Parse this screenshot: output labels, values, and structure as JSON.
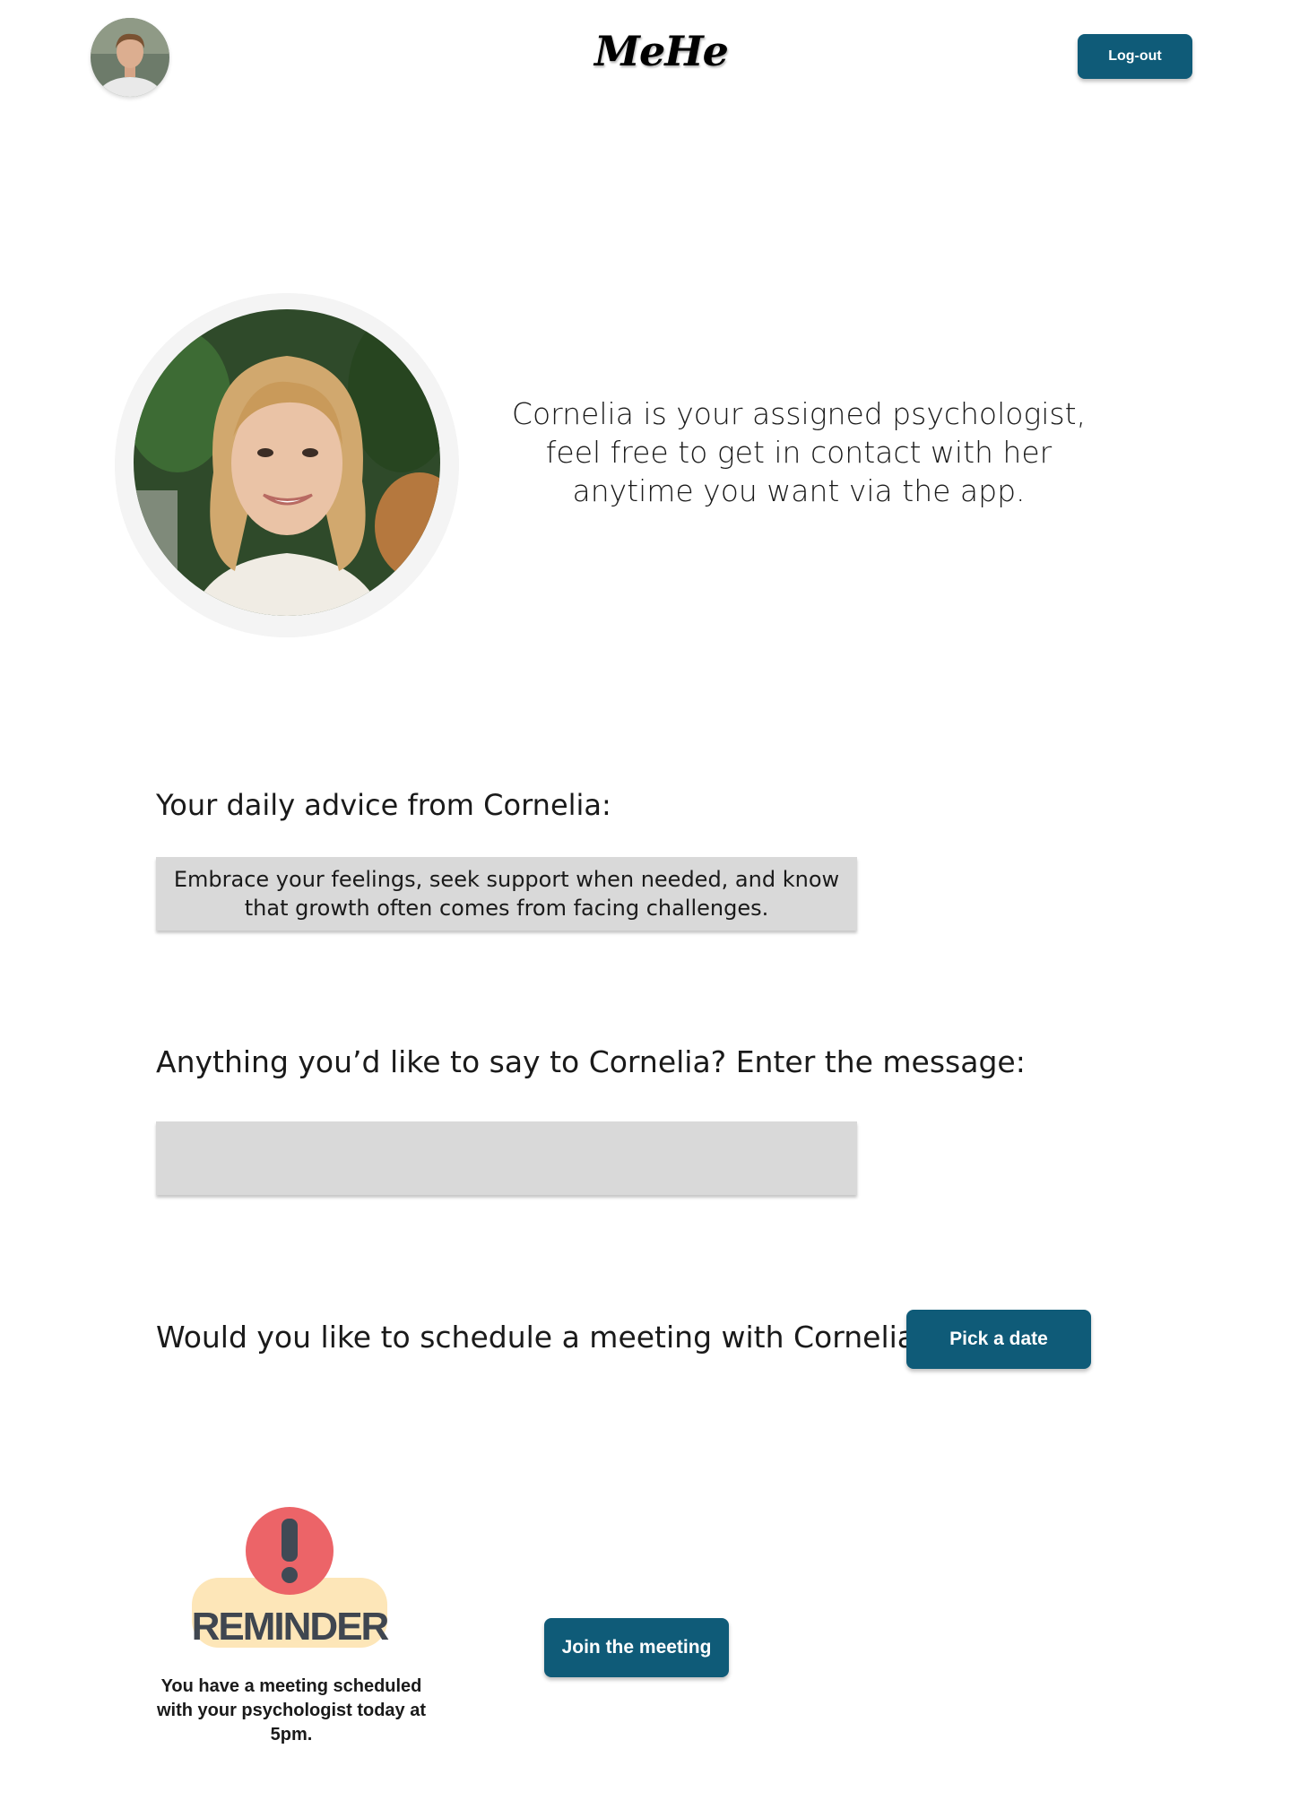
{
  "header": {
    "logo": "MeHe",
    "logout_label": "Log-out"
  },
  "psychologist": {
    "intro": "Cornelia is your assigned psychologist, feel free to get in contact with her anytime you want via the app."
  },
  "advice": {
    "heading": "Your daily advice from Cornelia:",
    "text": "Embrace your feelings, seek support when needed, and know that growth often comes from facing challenges."
  },
  "message": {
    "heading": "Anything you’d like to say to Cornelia? Enter the message:",
    "value": ""
  },
  "schedule": {
    "question": "Would you like to schedule a meeting with Cornelia?",
    "button_label": "Pick a date"
  },
  "reminder": {
    "badge_text": "REMINDER",
    "text": "You have a meeting scheduled with your psychologist today at 5pm.",
    "join_label": "Join the meeting"
  },
  "colors": {
    "primary_button": "#0f5b78",
    "input_background": "#d9d9d9",
    "reminder_circle": "#ec6468",
    "reminder_banner": "#fde6b8"
  },
  "icons": {
    "user_avatar": "user-photo",
    "psychologist_photo": "psychologist-photo",
    "reminder": "exclamation-reminder-icon"
  }
}
